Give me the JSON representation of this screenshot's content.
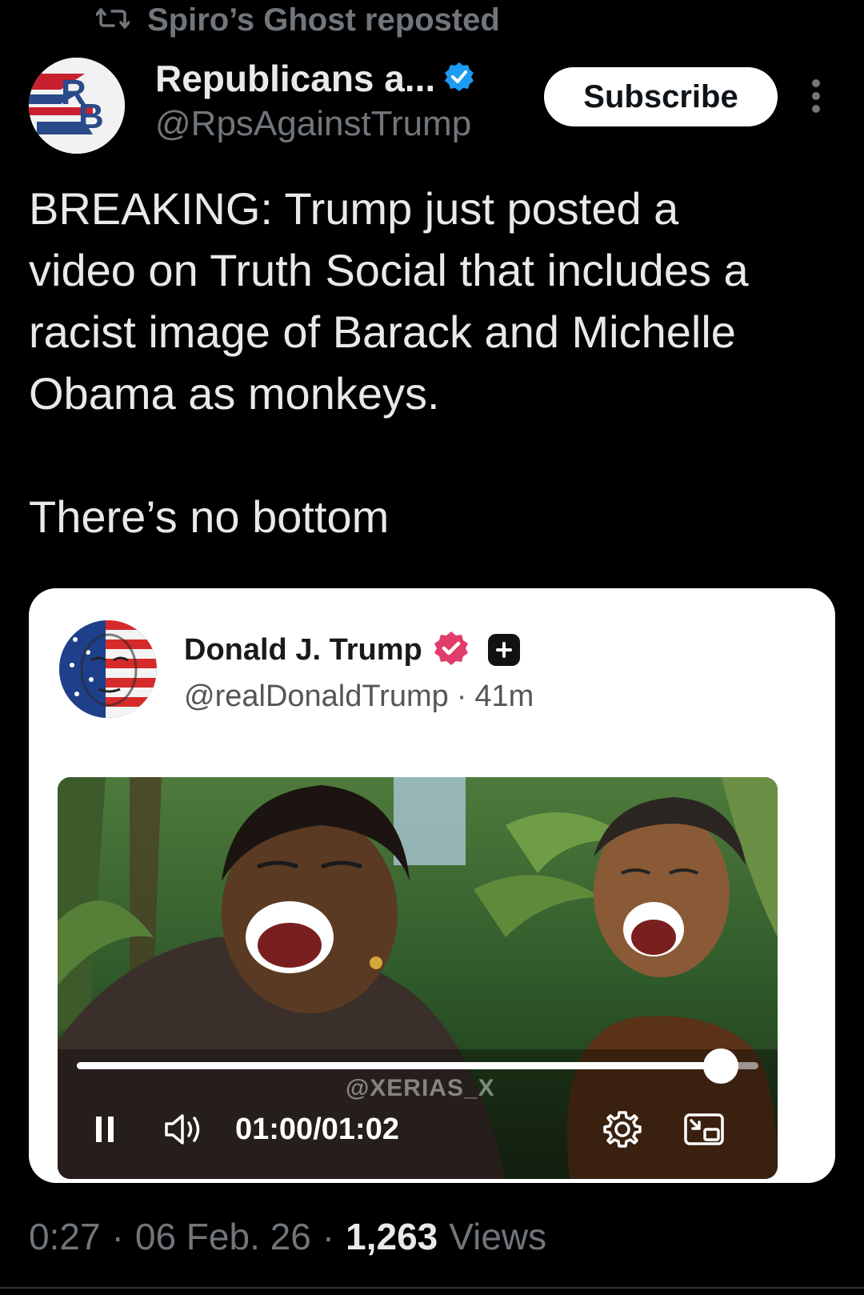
{
  "repost": {
    "text": "Spiro’s Ghost reposted",
    "icon": "repost-icon"
  },
  "author": {
    "name": "Republicans a...",
    "handle": "@RpsAgainstTrump",
    "verified": true,
    "avatar_letters": "RB",
    "verified_color": "#1d9bf0"
  },
  "subscribe_label": "Subscribe",
  "tweet": {
    "text": "BREAKING: Trump just posted a\nvideo on Truth Social that includes a\nracist image of Barack and Michelle\nObama as monkeys.\n\nThere’s no bottom"
  },
  "embed": {
    "name": "Donald J. Trump",
    "handle": "@realDonaldTrump",
    "separator": "·",
    "age": "41m",
    "badge_color": "#e23c6a",
    "video": {
      "watermark": "@XERIAS_X",
      "current_time": "01:00",
      "time_separator": "/",
      "duration": "01:02",
      "progress": 0.945
    }
  },
  "footer": {
    "time": "0:27",
    "sep1": "·",
    "date": "06 Feb. 26",
    "sep2": "·",
    "views_count": "1,263",
    "views_label": "Views"
  }
}
